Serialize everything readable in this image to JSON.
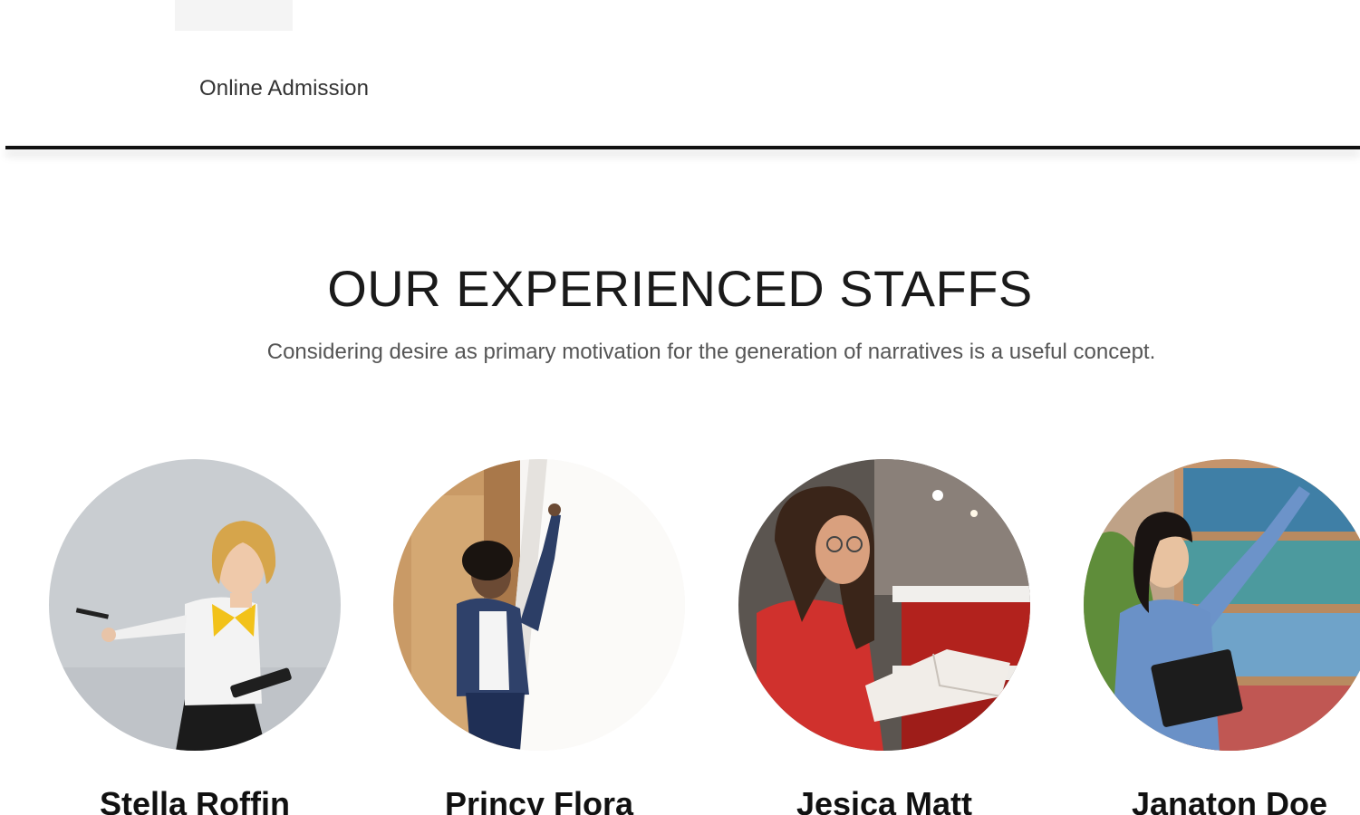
{
  "header": {
    "nav": {
      "online_admission": "Online Admission"
    }
  },
  "staff_section": {
    "title": "OUR EXPERIENCED STAFFS",
    "subtitle": "Considering desire as primary motivation for the generation of narratives is a useful concept.",
    "members": [
      {
        "name": "Stella Roffin",
        "photo": "teacher-pointing-photo"
      },
      {
        "name": "Princy Flora",
        "photo": "teacher-whiteboard-photo"
      },
      {
        "name": "Jesica Matt",
        "photo": "woman-reading-book-photo"
      },
      {
        "name": "Janaton Doe",
        "photo": "student-library-photo"
      }
    ]
  }
}
